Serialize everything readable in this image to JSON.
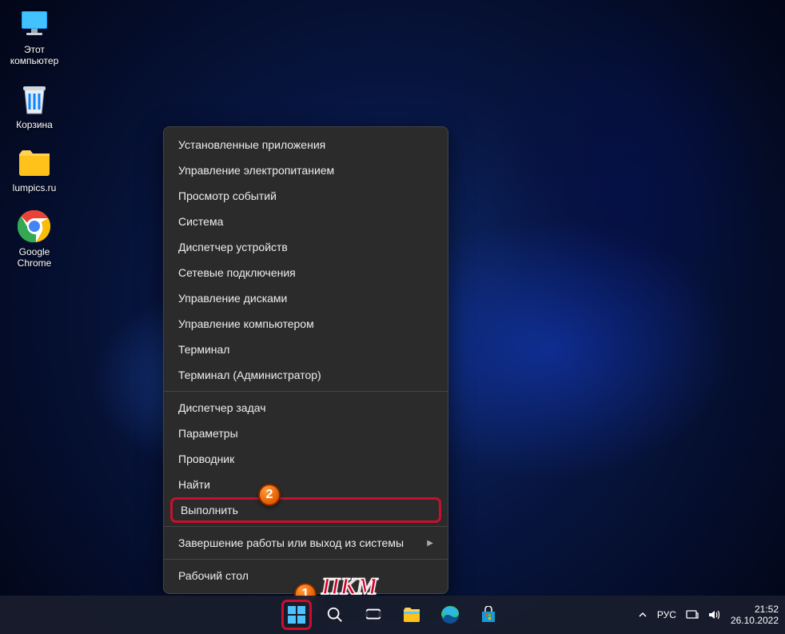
{
  "desktop_icons": [
    {
      "label": "Этот\nкомпьютер"
    },
    {
      "label": "Корзина"
    },
    {
      "label": "lumpics.ru"
    },
    {
      "label": "Google\nChrome"
    }
  ],
  "context_menu": {
    "groups": [
      [
        {
          "label": "Установленные приложения"
        },
        {
          "label": "Управление электропитанием"
        },
        {
          "label": "Просмотр событий"
        },
        {
          "label": "Система"
        },
        {
          "label": "Диспетчер устройств"
        },
        {
          "label": "Сетевые подключения"
        },
        {
          "label": "Управление дисками"
        },
        {
          "label": "Управление компьютером"
        },
        {
          "label": "Терминал"
        },
        {
          "label": "Терминал (Администратор)"
        }
      ],
      [
        {
          "label": "Диспетчер задач"
        },
        {
          "label": "Параметры"
        },
        {
          "label": "Проводник"
        },
        {
          "label": "Найти"
        },
        {
          "label": "Выполнить",
          "highlight": true
        }
      ],
      [
        {
          "label": "Завершение работы или выход из системы",
          "submenu": true
        }
      ],
      [
        {
          "label": "Рабочий стол"
        }
      ]
    ]
  },
  "annotations": {
    "badge1": "1",
    "badge2": "2",
    "pkm": "ПКМ"
  },
  "tray": {
    "lang": "РУС",
    "time": "21:52",
    "date": "26.10.2022"
  }
}
